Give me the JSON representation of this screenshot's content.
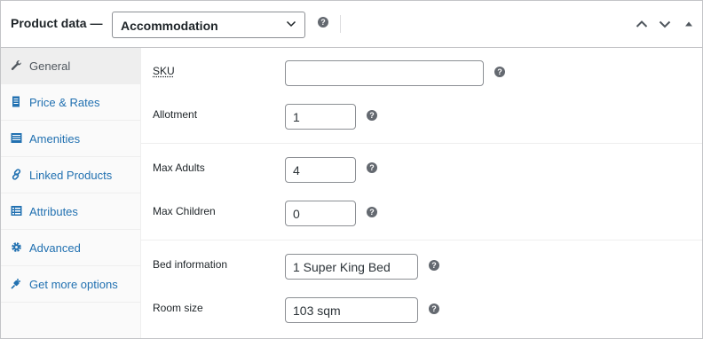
{
  "header": {
    "title": "Product data —",
    "product_type": "Accommodation",
    "help_icon": "help-icon",
    "actions": [
      "move-up-icon",
      "move-down-icon",
      "toggle-panel-icon"
    ]
  },
  "sidebar": {
    "items": [
      {
        "label": "General",
        "icon": "wrench-icon",
        "active": true
      },
      {
        "label": "Price & Rates",
        "icon": "document-icon",
        "active": false
      },
      {
        "label": "Amenities",
        "icon": "list-icon",
        "active": false
      },
      {
        "label": "Linked Products",
        "icon": "link-icon",
        "active": false
      },
      {
        "label": "Attributes",
        "icon": "table-icon",
        "active": false
      },
      {
        "label": "Advanced",
        "icon": "gear-icon",
        "active": false
      },
      {
        "label": "Get more options",
        "icon": "plug-icon",
        "active": false
      }
    ]
  },
  "general": {
    "sku": {
      "label": "SKU",
      "value": ""
    },
    "allotment": {
      "label": "Allotment",
      "value": "1"
    },
    "max_adults": {
      "label": "Max Adults",
      "value": "4"
    },
    "max_children": {
      "label": "Max Children",
      "value": "0"
    },
    "bed_information": {
      "label": "Bed information",
      "value": "1 Super King Bed"
    },
    "room_size": {
      "label": "Room size",
      "value": "103 sqm"
    },
    "help_glyph": "?"
  },
  "colors": {
    "link": "#2271b1",
    "border": "#c3c4c7",
    "sidebar_bg": "#fafafa",
    "active_tab_bg": "#eeeeee"
  }
}
